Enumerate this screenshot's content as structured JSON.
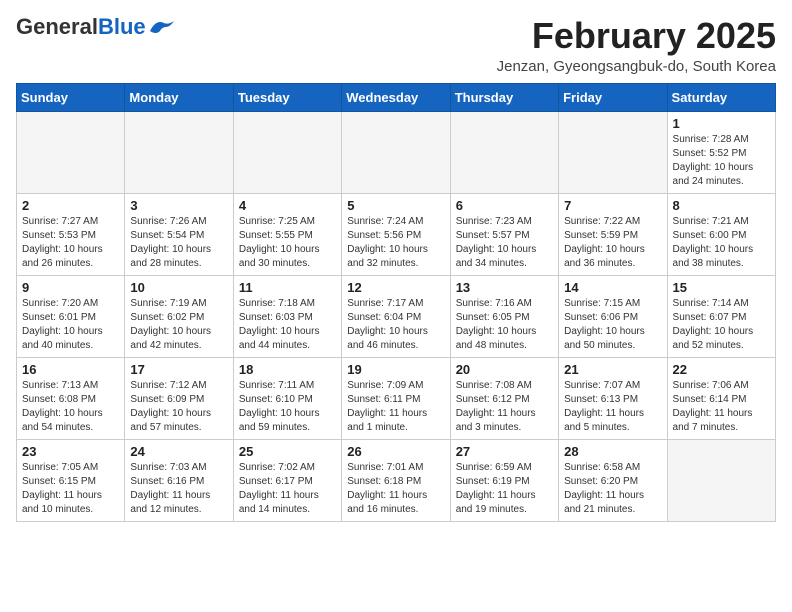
{
  "logo": {
    "general": "General",
    "blue": "Blue"
  },
  "title": {
    "month_year": "February 2025",
    "location": "Jenzan, Gyeongsangbuk-do, South Korea"
  },
  "headers": [
    "Sunday",
    "Monday",
    "Tuesday",
    "Wednesday",
    "Thursday",
    "Friday",
    "Saturday"
  ],
  "weeks": [
    [
      {
        "day": "",
        "info": ""
      },
      {
        "day": "",
        "info": ""
      },
      {
        "day": "",
        "info": ""
      },
      {
        "day": "",
        "info": ""
      },
      {
        "day": "",
        "info": ""
      },
      {
        "day": "",
        "info": ""
      },
      {
        "day": "1",
        "info": "Sunrise: 7:28 AM\nSunset: 5:52 PM\nDaylight: 10 hours and 24 minutes."
      }
    ],
    [
      {
        "day": "2",
        "info": "Sunrise: 7:27 AM\nSunset: 5:53 PM\nDaylight: 10 hours and 26 minutes."
      },
      {
        "day": "3",
        "info": "Sunrise: 7:26 AM\nSunset: 5:54 PM\nDaylight: 10 hours and 28 minutes."
      },
      {
        "day": "4",
        "info": "Sunrise: 7:25 AM\nSunset: 5:55 PM\nDaylight: 10 hours and 30 minutes."
      },
      {
        "day": "5",
        "info": "Sunrise: 7:24 AM\nSunset: 5:56 PM\nDaylight: 10 hours and 32 minutes."
      },
      {
        "day": "6",
        "info": "Sunrise: 7:23 AM\nSunset: 5:57 PM\nDaylight: 10 hours and 34 minutes."
      },
      {
        "day": "7",
        "info": "Sunrise: 7:22 AM\nSunset: 5:59 PM\nDaylight: 10 hours and 36 minutes."
      },
      {
        "day": "8",
        "info": "Sunrise: 7:21 AM\nSunset: 6:00 PM\nDaylight: 10 hours and 38 minutes."
      }
    ],
    [
      {
        "day": "9",
        "info": "Sunrise: 7:20 AM\nSunset: 6:01 PM\nDaylight: 10 hours and 40 minutes."
      },
      {
        "day": "10",
        "info": "Sunrise: 7:19 AM\nSunset: 6:02 PM\nDaylight: 10 hours and 42 minutes."
      },
      {
        "day": "11",
        "info": "Sunrise: 7:18 AM\nSunset: 6:03 PM\nDaylight: 10 hours and 44 minutes."
      },
      {
        "day": "12",
        "info": "Sunrise: 7:17 AM\nSunset: 6:04 PM\nDaylight: 10 hours and 46 minutes."
      },
      {
        "day": "13",
        "info": "Sunrise: 7:16 AM\nSunset: 6:05 PM\nDaylight: 10 hours and 48 minutes."
      },
      {
        "day": "14",
        "info": "Sunrise: 7:15 AM\nSunset: 6:06 PM\nDaylight: 10 hours and 50 minutes."
      },
      {
        "day": "15",
        "info": "Sunrise: 7:14 AM\nSunset: 6:07 PM\nDaylight: 10 hours and 52 minutes."
      }
    ],
    [
      {
        "day": "16",
        "info": "Sunrise: 7:13 AM\nSunset: 6:08 PM\nDaylight: 10 hours and 54 minutes."
      },
      {
        "day": "17",
        "info": "Sunrise: 7:12 AM\nSunset: 6:09 PM\nDaylight: 10 hours and 57 minutes."
      },
      {
        "day": "18",
        "info": "Sunrise: 7:11 AM\nSunset: 6:10 PM\nDaylight: 10 hours and 59 minutes."
      },
      {
        "day": "19",
        "info": "Sunrise: 7:09 AM\nSunset: 6:11 PM\nDaylight: 11 hours and 1 minute."
      },
      {
        "day": "20",
        "info": "Sunrise: 7:08 AM\nSunset: 6:12 PM\nDaylight: 11 hours and 3 minutes."
      },
      {
        "day": "21",
        "info": "Sunrise: 7:07 AM\nSunset: 6:13 PM\nDaylight: 11 hours and 5 minutes."
      },
      {
        "day": "22",
        "info": "Sunrise: 7:06 AM\nSunset: 6:14 PM\nDaylight: 11 hours and 7 minutes."
      }
    ],
    [
      {
        "day": "23",
        "info": "Sunrise: 7:05 AM\nSunset: 6:15 PM\nDaylight: 11 hours and 10 minutes."
      },
      {
        "day": "24",
        "info": "Sunrise: 7:03 AM\nSunset: 6:16 PM\nDaylight: 11 hours and 12 minutes."
      },
      {
        "day": "25",
        "info": "Sunrise: 7:02 AM\nSunset: 6:17 PM\nDaylight: 11 hours and 14 minutes."
      },
      {
        "day": "26",
        "info": "Sunrise: 7:01 AM\nSunset: 6:18 PM\nDaylight: 11 hours and 16 minutes."
      },
      {
        "day": "27",
        "info": "Sunrise: 6:59 AM\nSunset: 6:19 PM\nDaylight: 11 hours and 19 minutes."
      },
      {
        "day": "28",
        "info": "Sunrise: 6:58 AM\nSunset: 6:20 PM\nDaylight: 11 hours and 21 minutes."
      },
      {
        "day": "",
        "info": ""
      }
    ]
  ]
}
